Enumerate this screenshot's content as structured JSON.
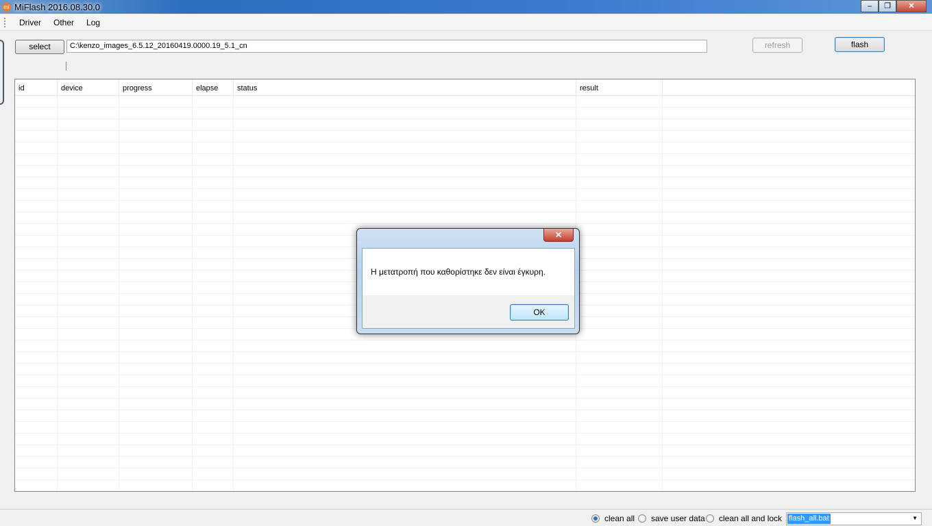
{
  "window": {
    "title": "MiFlash 2016.08.30.0",
    "icon": "mi-logo-icon",
    "min": "‒",
    "max": "❐",
    "close": "✕"
  },
  "menu": [
    "Driver",
    "Other",
    "Log"
  ],
  "toolbar": {
    "select_label": "select",
    "path": "C:\\kenzo_images_6.5.12_20160419.0000.19_5.1_cn",
    "refresh_label": "refresh",
    "flash_label": "flash"
  },
  "grid": {
    "columns": [
      "id",
      "device",
      "progress",
      "elapse",
      "status",
      "result"
    ]
  },
  "bottom": {
    "options": [
      "clean all",
      "save user data",
      "clean all and lock"
    ],
    "selected": 0,
    "script": "flash_all.bat",
    "dropdown_icon": "▼"
  },
  "dialog": {
    "message": "Η μετατροπή που καθορίστηκε δεν είναι έγκυρη.",
    "ok_label": "OK",
    "close": "✕"
  }
}
